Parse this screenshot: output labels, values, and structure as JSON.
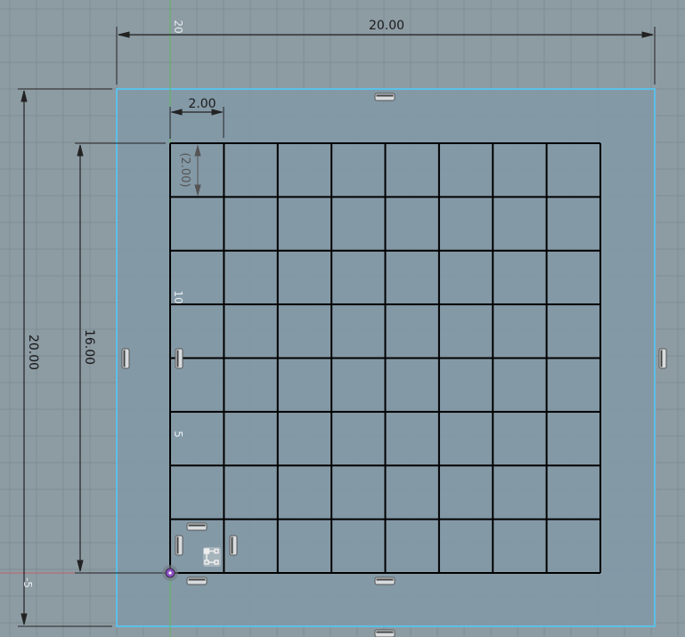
{
  "viewport": {
    "background_color": "#8d9ba3",
    "grid_color": "#7f8d95",
    "profile_fill": "#8299a7",
    "profile_outline_color": "#5bc0e8",
    "sketch_line_color": "#000000",
    "x_axis_color": "#c0636b",
    "y_axis_color": "#5fb85f",
    "origin_color": "#8a4fc2"
  },
  "dimensions": {
    "overall_width": "20.00",
    "overall_height": "20.00",
    "grid_height": "16.00",
    "cell_width": "2.00",
    "cell_height": "(2.00)"
  },
  "axis_labels": {
    "top": "20",
    "mid": "10",
    "low": "5",
    "neg": "-5"
  },
  "sketch": {
    "grid_columns": 8,
    "grid_rows": 8
  },
  "constraints": {
    "horizontal_icon": "horizontal-constraint-icon",
    "vertical_icon": "vertical-constraint-icon",
    "pattern_icon": "rectangular-pattern-icon"
  }
}
